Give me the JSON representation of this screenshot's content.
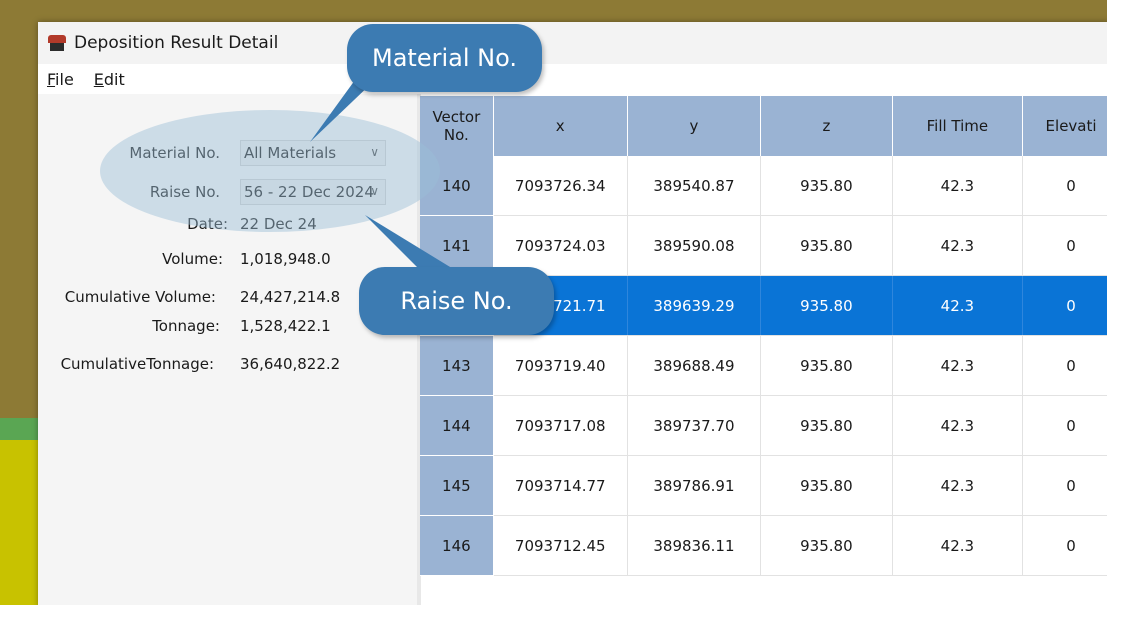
{
  "window": {
    "title": "Deposition Result Detail"
  },
  "menu": {
    "file": "File",
    "edit": "Edit"
  },
  "form": {
    "material_label": "Material No.",
    "material_value": "All Materials",
    "raise_label": "Raise No.",
    "raise_value": "56 - 22 Dec 2024",
    "date_label": "Date:",
    "date_value": "22 Dec 24",
    "volume_label": "Volume:",
    "volume_value": "1,018,948.0",
    "cumvol_label": "Cumulative Volume:",
    "cumvol_value": "24,427,214.8",
    "tonnage_label": "Tonnage:",
    "tonnage_value": "1,528,422.1",
    "cumton_label": "CumulativeTonnage:",
    "cumton_value": "36,640,822.2"
  },
  "grid": {
    "columns": [
      "Vector No.",
      "x",
      "y",
      "z",
      "Fill Time",
      "Elevati"
    ],
    "rows": [
      [
        "140",
        "7093726.34",
        "389540.87",
        "935.80",
        "42.3",
        "0"
      ],
      [
        "141",
        "7093724.03",
        "389590.08",
        "935.80",
        "42.3",
        "0"
      ],
      [
        "",
        "7093721.71",
        "389639.29",
        "935.80",
        "42.3",
        "0"
      ],
      [
        "143",
        "7093719.40",
        "389688.49",
        "935.80",
        "42.3",
        "0"
      ],
      [
        "144",
        "7093717.08",
        "389737.70",
        "935.80",
        "42.3",
        "0"
      ],
      [
        "145",
        "7093714.77",
        "389786.91",
        "935.80",
        "42.3",
        "0"
      ],
      [
        "146",
        "7093712.45",
        "389836.11",
        "935.80",
        "42.3",
        "0"
      ]
    ],
    "selected_row_index": 2
  },
  "callouts": {
    "material": "Material No.",
    "raise": "Raise No."
  },
  "colors": {
    "header": "#9ab3d3",
    "selection": "#0a74d6",
    "callout": "#3c7bb2"
  }
}
